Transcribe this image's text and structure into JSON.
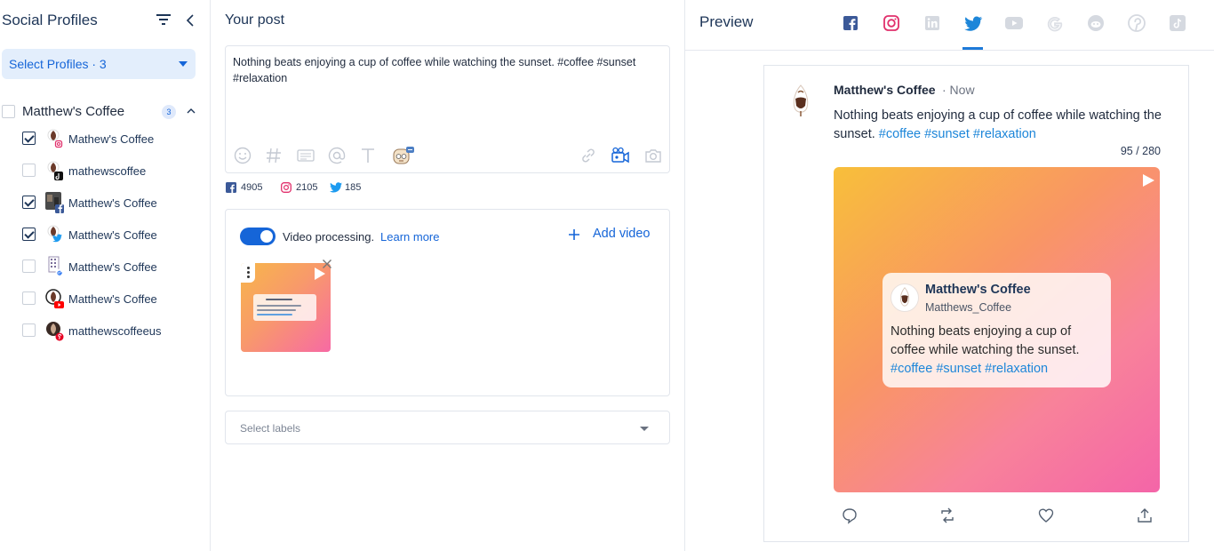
{
  "sidebar": {
    "title": "Social Profiles",
    "select_label": "Select Profiles · 3",
    "group": {
      "name": "Matthew's Coffee",
      "count": "3"
    },
    "profiles": [
      {
        "name": "Mathew's Coffee",
        "checked": true,
        "network": "instagram"
      },
      {
        "name": "mathewscoffee",
        "checked": false,
        "network": "tiktok"
      },
      {
        "name": "Matthew's Coffee",
        "checked": true,
        "network": "facebook"
      },
      {
        "name": "Matthew's Coffee",
        "checked": true,
        "network": "twitter"
      },
      {
        "name": "Matthew's Coffee",
        "checked": false,
        "network": "google"
      },
      {
        "name": "Matthew's Coffee",
        "checked": false,
        "network": "youtube"
      },
      {
        "name": "matthewscoffeeus",
        "checked": false,
        "network": "pinterest"
      }
    ]
  },
  "post": {
    "title": "Your post",
    "text": " Nothing beats enjoying a cup of coffee while watching the sunset. #coffee #sunset #relaxation",
    "counts": {
      "facebook": "4905",
      "instagram": "2105",
      "twitter": "185"
    },
    "video_processing_label": "Video processing.",
    "learn_more": "Learn more",
    "add_video": "Add video",
    "labels_placeholder": "Select labels"
  },
  "preview": {
    "title": "Preview",
    "tabs": [
      "facebook-icon",
      "instagram-icon",
      "linkedin-icon",
      "twitter-icon",
      "youtube-icon",
      "google-icon",
      "reddit-icon",
      "pinterest-icon",
      "tiktok-icon"
    ],
    "active_tab": "twitter",
    "author": "Matthew's Coffee",
    "time": "· Now",
    "body_plain": "Nothing beats enjoying a cup of coffee while watching the sunset.",
    "hashtags": "#coffee #sunset #relaxation",
    "counter": "95 / 280",
    "card": {
      "name": "Matthew's Coffee",
      "handle": "Matthews_Coffee",
      "body_plain": "Nothing beats enjoying a cup of coffee while watching the sunset.",
      "hashtags": "#coffee #sunset #relaxation"
    }
  },
  "colors": {
    "accent": "#1565d8",
    "twitter": "#1d86d9",
    "instagram": "#e1306c",
    "facebook": "#3b5998"
  }
}
